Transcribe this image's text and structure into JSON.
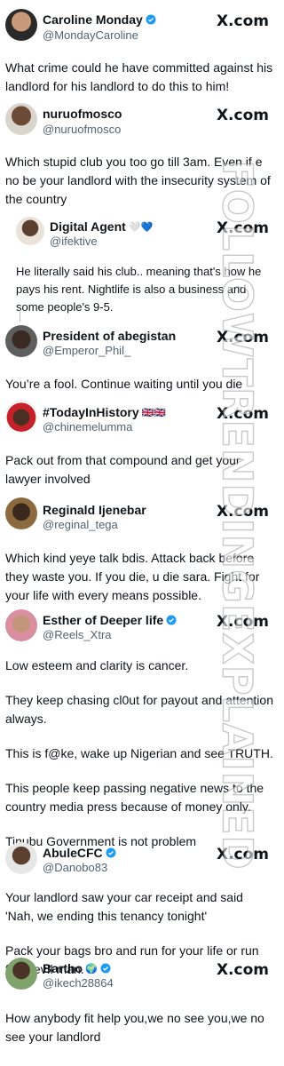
{
  "brand": "X.com",
  "colors": {
    "verified": "#1d9bf0",
    "handle": "#536471",
    "text": "#0f1419"
  },
  "watermark": "FOLLOWTRENDINGEXPLAINED",
  "tweets": [
    {
      "name": "Caroline Monday",
      "handle": "@MondayCaroline",
      "verified": true,
      "paragraphs": [
        "What crime could he have committed against his landlord for his landlord to do this to him!"
      ]
    },
    {
      "name": "nuruofmosco",
      "handle": "@nuruofmosco",
      "verified": false,
      "paragraphs": [
        "Which stupid club you too go till 3am. Even if e no be your landlord with the insecurity system of the country"
      ]
    },
    {
      "name": "Digital Agent",
      "name_suffix": "🤍💙",
      "handle": "@ifektive",
      "verified": false,
      "paragraphs": [
        "He literally said his club.. meaning that's how he pays his rent. Nightlife is also a business and some people's 9-5."
      ]
    },
    {
      "name": "President of abegistan",
      "handle": "@Emperor_Phil_",
      "verified": false,
      "paragraphs": [
        "You’re a fool. Continue waiting until you die"
      ]
    },
    {
      "name": "#TodayInHistory",
      "name_suffix": "🇬🇧🇬🇧",
      "handle": "@chinemelumma",
      "verified": false,
      "paragraphs": [
        "Pack out from that compound and get your lawyer involved"
      ]
    },
    {
      "name": "Reginald Ijenebar",
      "handle": "@reginal_tega",
      "verified": false,
      "paragraphs": [
        "Which kind yeye talk bdis. Attack back before they waste you. If you die, u die sara. Fight for your life with every means possible."
      ]
    },
    {
      "name": "Esther of Deeper life",
      "handle": "@Reels_Xtra",
      "verified": true,
      "paragraphs": [
        "Low esteem and clarity is cancer.",
        "They keep chasing cl0ut for payout and attention always.",
        "This is f@ke, wake up Nigerian and see TRUTH.",
        "This people keep passing negative news to the country media press because of money only.",
        "Tinubu Government is not problem"
      ]
    },
    {
      "name": "AbuleCFC",
      "handle": "@Danobo83",
      "verified": true,
      "paragraphs": [
        "Your landlord saw your car receipt and said 'Nah, we ending this tenancy tonight'",
        "Pack your bags bro and run for your life or run from ev!l man."
      ]
    },
    {
      "name": "Bartho",
      "name_suffix": "🌍",
      "handle": "@ikech28864",
      "verified": true,
      "paragraphs": [
        "How anybody fit help you,we no see you,we no see your landlord"
      ]
    }
  ]
}
